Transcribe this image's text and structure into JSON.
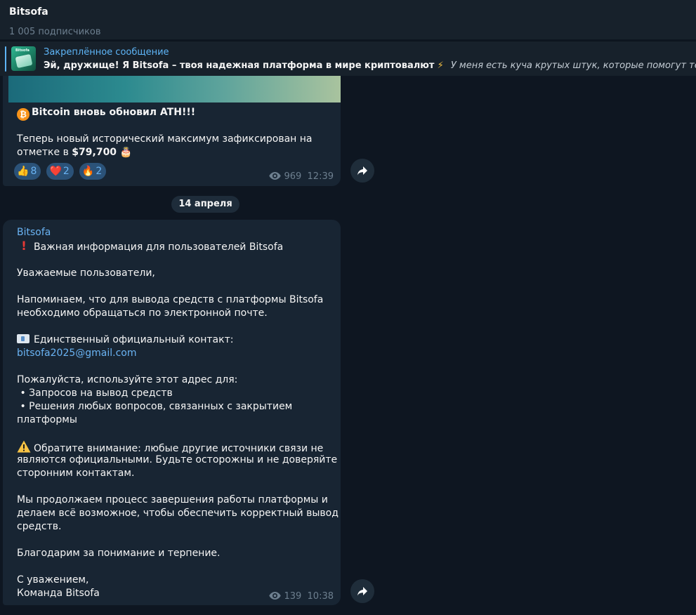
{
  "header": {
    "title": "Bitsofa",
    "subscribers": "1 005 подписчиков"
  },
  "pinned": {
    "label": "Закреплённое сообщение",
    "bold_text": "Эй, дружище! Я Bitsofa – твоя надежная платформа в мире криптовалют",
    "italic_text": "У меня есть куча крутых штук, которые помогут тебе",
    "thumb_label": "Bitsofa"
  },
  "post1": {
    "headline": "Bitcoin вновь обновил ATH!!!",
    "line1": "Теперь новый исторический максимум зафиксирован на",
    "line2_prefix": "отметке в ",
    "line2_amount": "$79,700",
    "reactions": [
      {
        "emoji": "👍",
        "count": "8"
      },
      {
        "emoji": "❤️",
        "count": "2"
      },
      {
        "emoji": "🔥",
        "count": "2"
      }
    ],
    "views": "969",
    "time": "12:39"
  },
  "date_separator": "14 апреля",
  "post2": {
    "author": "Bitsofa",
    "title": "Важная информация для пользователей Bitsofa",
    "greeting": "Уважаемые пользователи,",
    "p1_l1": "Напоминаем, что для вывода средств с платформы Bitsofa",
    "p1_l2": "необходимо обращаться по электронной почте.",
    "contact_label": "Единственный официальный контакт:",
    "email": "bitsofa2025@gmail.com",
    "use_for": "Пожалуйста, используйте этот адрес для:",
    "bullet1": " • Запросов на вывод средств",
    "bullet2": " • Решения любых вопросов, связанных с закрытием",
    "bullet2_cont": "платформы",
    "warn_l1": "Обратите внимание: любые другие источники связи не",
    "warn_l2": "являются официальными. Будьте осторожны и не доверяйте",
    "warn_l3": "сторонним контактам.",
    "p3_l1": "Мы продолжаем процесс завершения работы платформы и",
    "p3_l2": "делаем всё возможное, чтобы обеспечить корректный вывод",
    "p3_l3": "средств.",
    "thanks": "Благодарим за понимание и терпение.",
    "regards": "С уважением,",
    "signature": "Команда Bitsofa",
    "views": "139",
    "time": "10:38"
  },
  "colors": {
    "background": "#0e1621",
    "bubble": "#182533",
    "accent": "#6ab3f3",
    "meta": "#6d7f8f"
  }
}
